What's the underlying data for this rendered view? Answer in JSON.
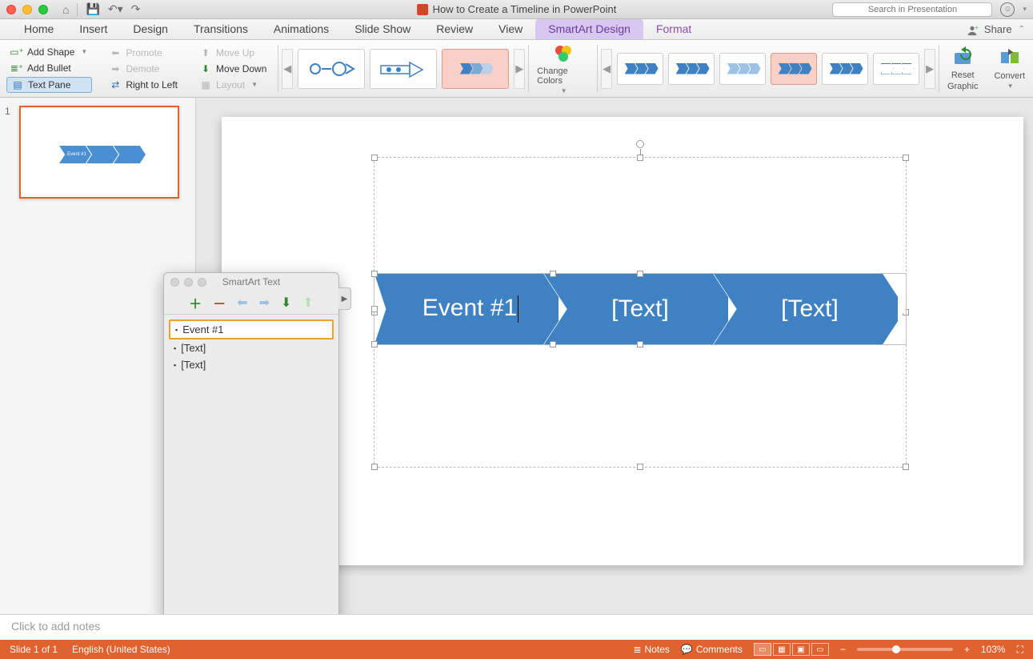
{
  "app": {
    "title": "How to Create a Timeline in PowerPoint",
    "search_placeholder": "Search in Presentation"
  },
  "ribbon_tabs": {
    "home": "Home",
    "insert": "Insert",
    "design": "Design",
    "transitions": "Transitions",
    "animations": "Animations",
    "slideshow": "Slide Show",
    "review": "Review",
    "view": "View",
    "smartart_design": "SmartArt Design",
    "format": "Format",
    "share": "Share"
  },
  "ribbon": {
    "add_shape": "Add Shape",
    "add_bullet": "Add Bullet",
    "text_pane": "Text Pane",
    "promote": "Promote",
    "demote": "Demote",
    "right_to_left": "Right to Left",
    "move_up": "Move Up",
    "move_down": "Move Down",
    "layout": "Layout",
    "change_colors": "Change Colors",
    "reset_graphic_l1": "Reset",
    "reset_graphic_l2": "Graphic",
    "convert": "Convert"
  },
  "textpane": {
    "title": "SmartArt Text",
    "items": [
      "Event #1",
      "[Text]",
      "[Text]"
    ]
  },
  "slide": {
    "chevrons": [
      "Event #1",
      "[Text]",
      "[Text]"
    ],
    "thumb_label": "Event #1"
  },
  "thumb_number": "1",
  "notes_placeholder": "Click to add notes",
  "status": {
    "slide_info": "Slide 1 of 1",
    "language": "English (United States)",
    "notes": "Notes",
    "comments": "Comments",
    "zoom": "103%"
  },
  "icons": {
    "plus_green": "＋",
    "minus_red": "－",
    "arrow_left": "⬅",
    "arrow_right": "➡",
    "arrow_down": "⬇",
    "arrow_up": "⬆"
  }
}
